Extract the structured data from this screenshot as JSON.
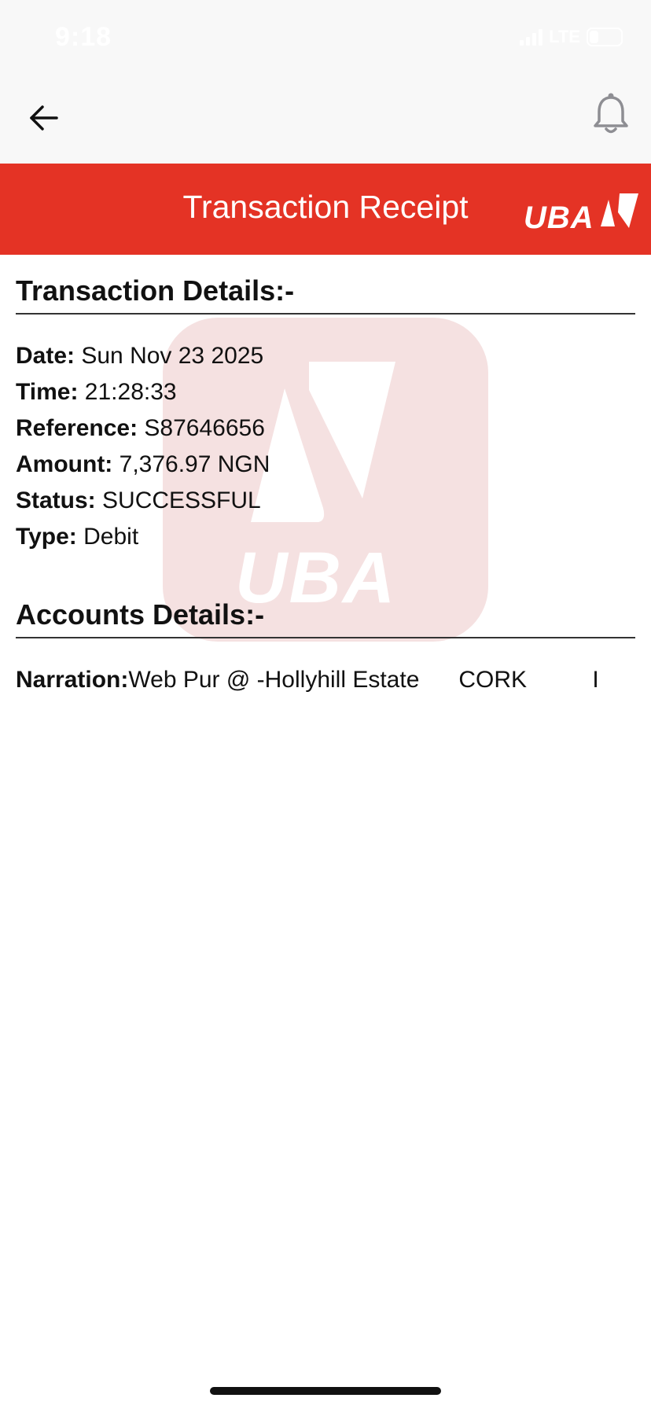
{
  "status_bar": {
    "time": "9:18",
    "network": "LTE",
    "battery": "30",
    "battery_level": 0.3
  },
  "nav": {
    "back_icon": "arrow-left-icon",
    "notification_icon": "bell-icon"
  },
  "header": {
    "title": "Transaction Receipt",
    "logo_text": "UBA",
    "background_color": "#e43325"
  },
  "transaction_details": {
    "section_title": "Transaction Details:-",
    "fields": [
      {
        "label": "Date:",
        "value": " Sun Nov 23 2025"
      },
      {
        "label": "Time:",
        "value": " 21:28:33"
      },
      {
        "label": "Reference:",
        "value": " S87646656"
      },
      {
        "label": "Amount:",
        "value": " 7,376.97 NGN"
      },
      {
        "label": "Status:",
        "value": " SUCCESSFUL"
      },
      {
        "label": "Type:",
        "value": " Debit"
      }
    ]
  },
  "accounts_details": {
    "section_title": "Accounts Details:-",
    "narration_label": "Narration:",
    "narration_value": "Web Pur @ -Hollyhill Estate      CORK          I"
  },
  "watermark": {
    "text": "UBA",
    "color": "#f5e1e1"
  }
}
